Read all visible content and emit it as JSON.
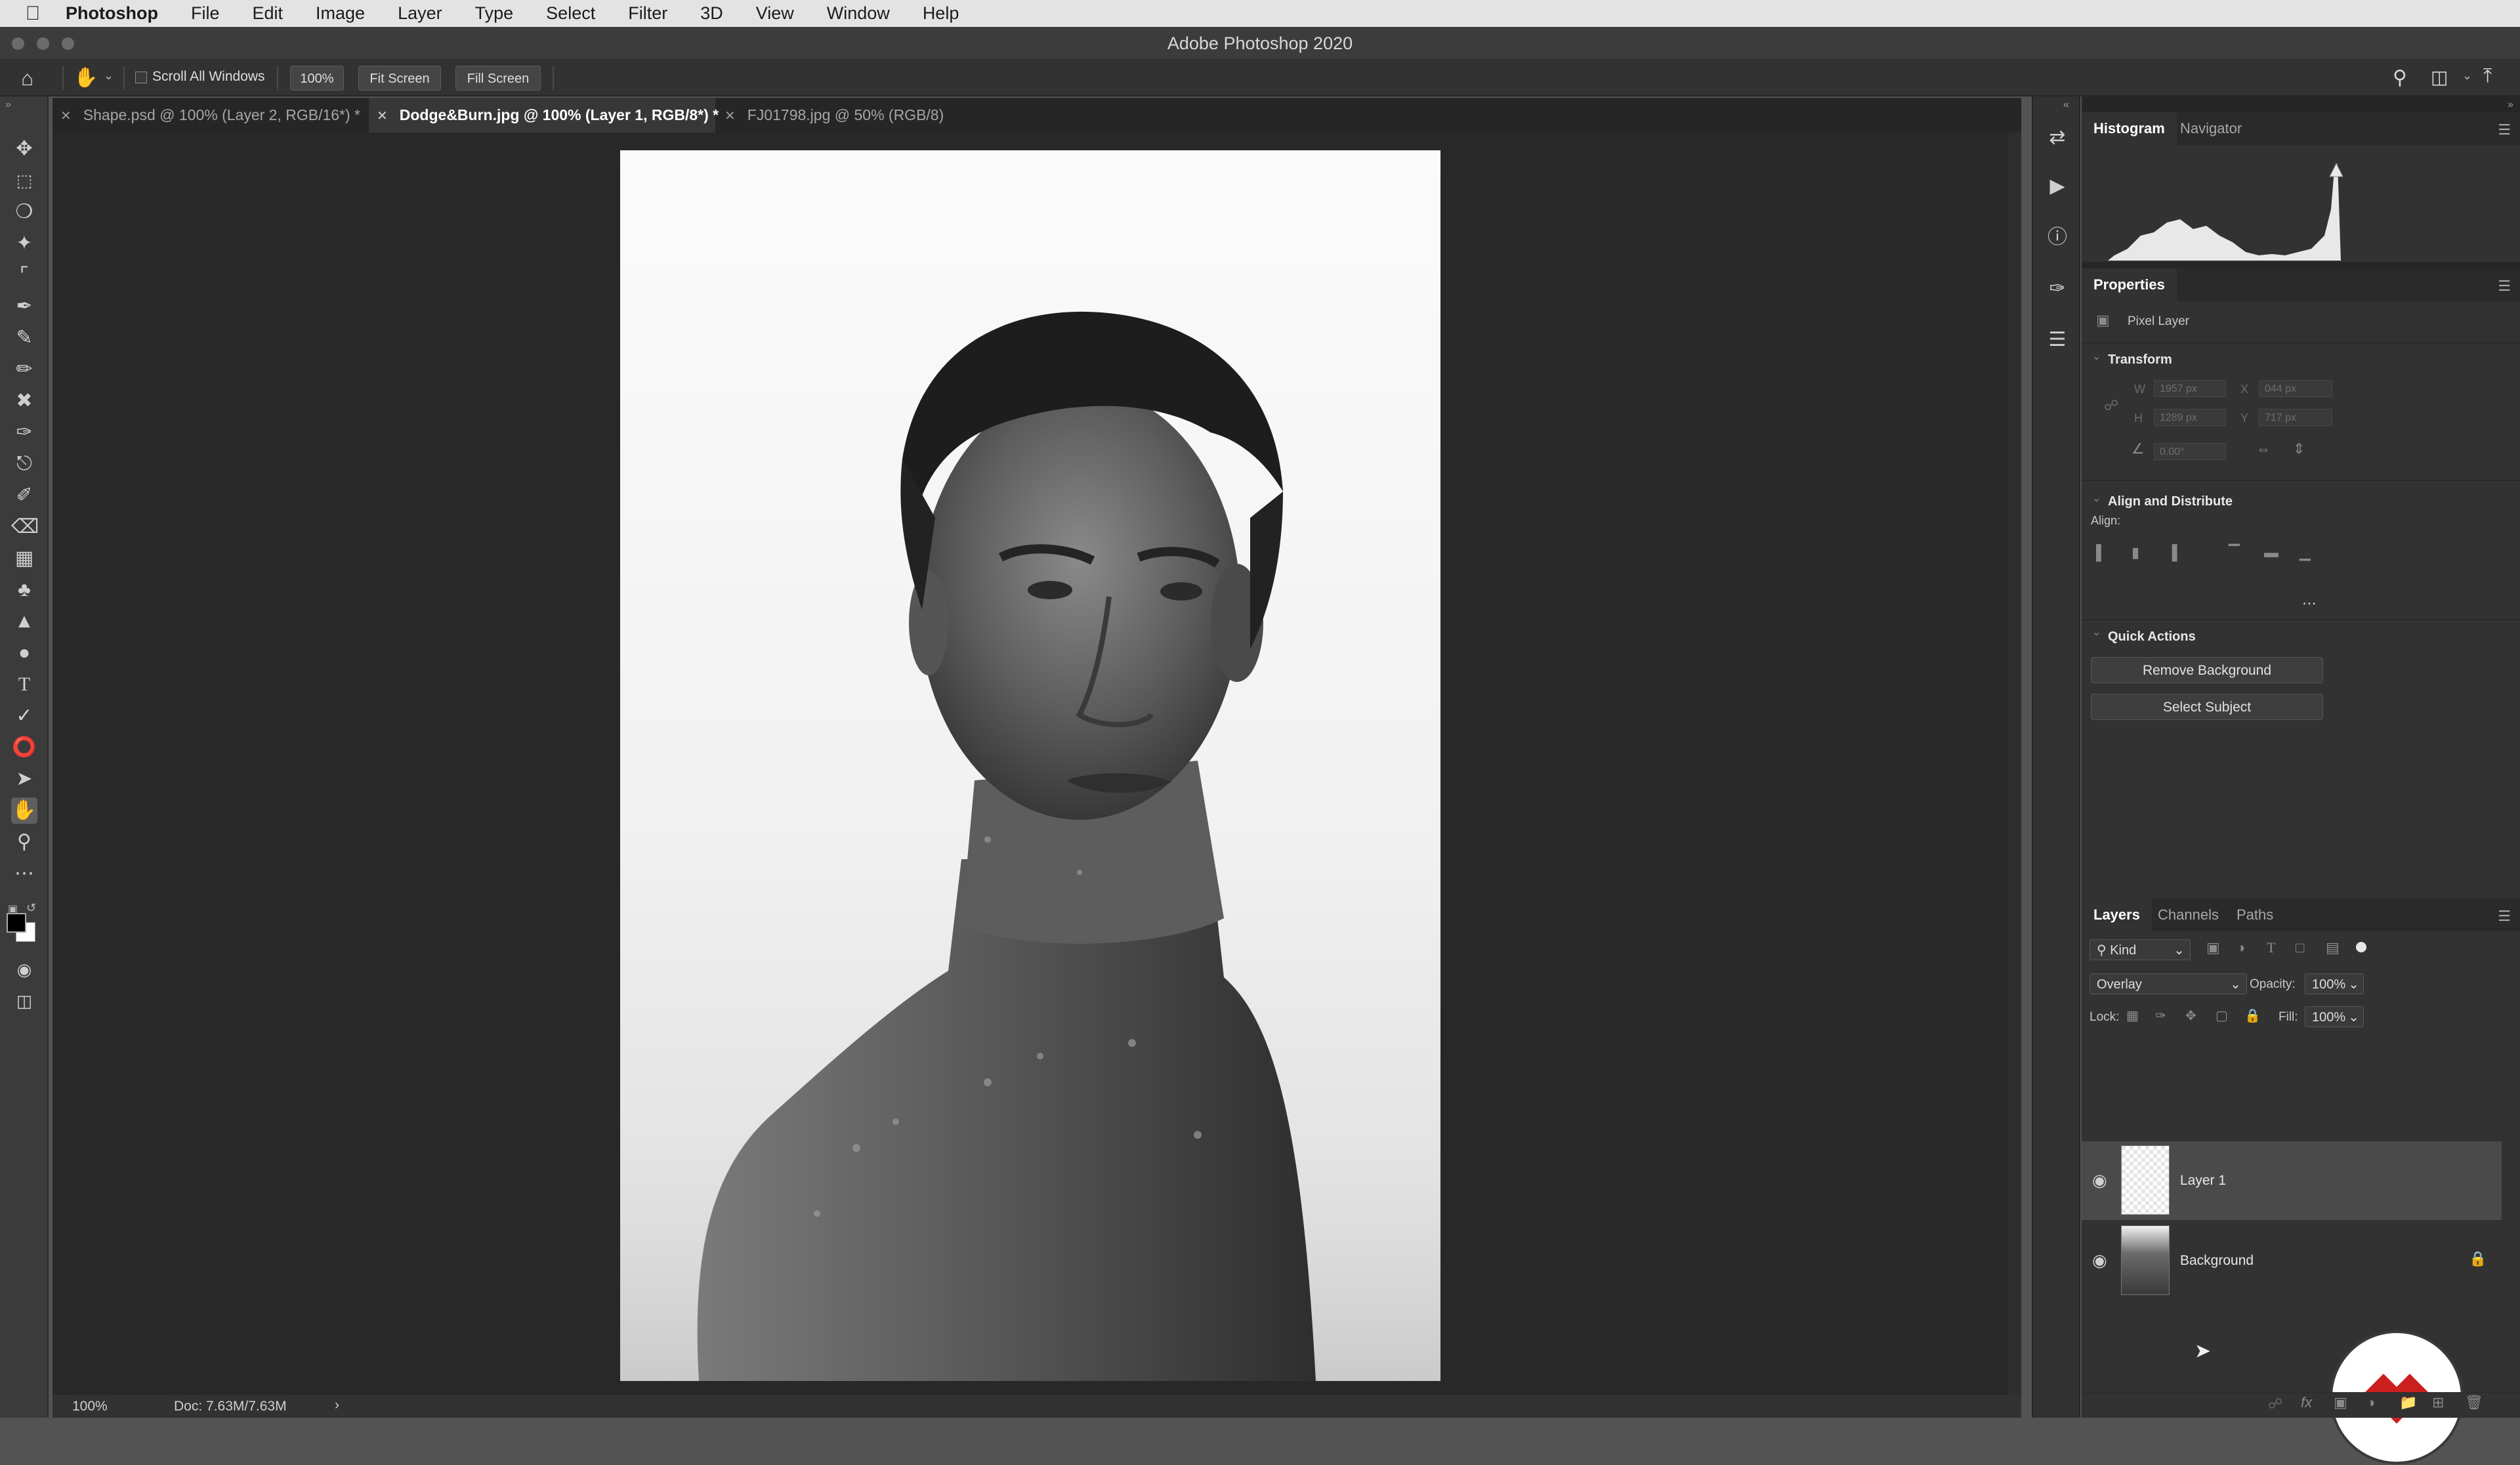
{
  "menubar": {
    "app_name": "Photoshop",
    "items": [
      "File",
      "Edit",
      "Image",
      "Layer",
      "Type",
      "Select",
      "Filter",
      "3D",
      "View",
      "Window",
      "Help"
    ]
  },
  "window": {
    "title": "Adobe Photoshop 2020"
  },
  "options": {
    "scroll_all_windows": "Scroll All Windows",
    "zoom": "100%",
    "fit_screen": "Fit Screen",
    "fill_screen": "Fill Screen"
  },
  "tabs": [
    {
      "label": "Shape.psd @ 100% (Layer 2, RGB/16*) *",
      "active": false
    },
    {
      "label": "Dodge&Burn.jpg @ 100% (Layer 1, RGB/8*) *",
      "active": true
    },
    {
      "label": "FJ01798.jpg @ 50% (RGB/8)",
      "active": false
    }
  ],
  "status": {
    "zoom": "100%",
    "doc": "Doc: 7.63M/7.63M",
    "arrow": "›"
  },
  "histogram_panel": {
    "tabs": [
      "Histogram",
      "Navigator"
    ]
  },
  "properties_panel": {
    "title": "Properties",
    "layer_type": "Pixel Layer",
    "transform": {
      "title": "Transform",
      "w_label": "W",
      "w_value": "1957 px",
      "x_label": "X",
      "x_value": "044 px",
      "h_label": "H",
      "h_value": "1289 px",
      "y_label": "Y",
      "y_value": "717 px",
      "angle_value": "0.00°"
    },
    "align": {
      "title": "Align and Distribute",
      "label": "Align:",
      "more": "..."
    },
    "quick_actions": {
      "title": "Quick Actions",
      "remove_background": "Remove Background",
      "select_subject": "Select Subject"
    }
  },
  "layers_panel": {
    "tabs": [
      "Layers",
      "Channels",
      "Paths"
    ],
    "filter_kind": "Kind",
    "blend_mode": "Overlay",
    "opacity_label": "Opacity:",
    "opacity_value": "100%",
    "lock_label": "Lock:",
    "fill_label": "Fill:",
    "fill_value": "100%",
    "layers": [
      {
        "name": "Layer 1",
        "selected": true,
        "locked": false
      },
      {
        "name": "Background",
        "selected": false,
        "locked": true
      }
    ]
  },
  "colors": {
    "accent_logo": "#cc1f1f",
    "panel_bg": "#323232",
    "canvas_bg": "#282828"
  }
}
